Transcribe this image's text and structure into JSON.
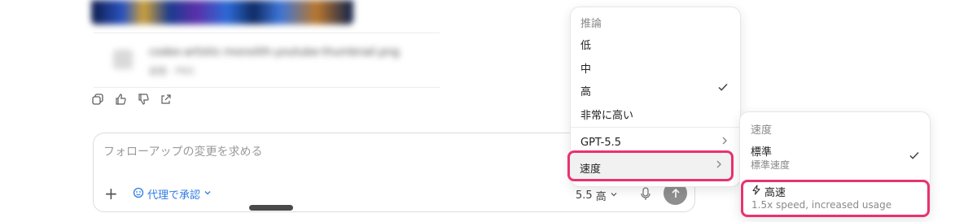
{
  "attachment": {
    "name": "codex-artistic-monolith-youtube-thumbnail.png",
    "meta": "画像 · PNG"
  },
  "composer": {
    "placeholder": "フォローアップの変更を求める",
    "agent_label": "代理で承認",
    "model_version": "5.5",
    "model_level": "高"
  },
  "reasoning_menu": {
    "header": "推論",
    "items": [
      {
        "label": "低",
        "selected": false
      },
      {
        "label": "中",
        "selected": false
      },
      {
        "label": "高",
        "selected": true
      },
      {
        "label": "非常に高い",
        "selected": false
      }
    ],
    "model_item": "GPT-5.5",
    "speed_item": "速度"
  },
  "speed_menu": {
    "header": "速度",
    "standard_title": "標準",
    "standard_desc": "標準速度",
    "fast_title": "高速",
    "fast_desc": "1.5x speed, increased usage"
  },
  "icons": {
    "check": "checkmark-icon",
    "chevron": "chevron-right-icon",
    "bolt": "bolt-icon"
  },
  "colors": {
    "highlight_border": "#e8336f",
    "agent_blue": "#2f7ae5"
  }
}
